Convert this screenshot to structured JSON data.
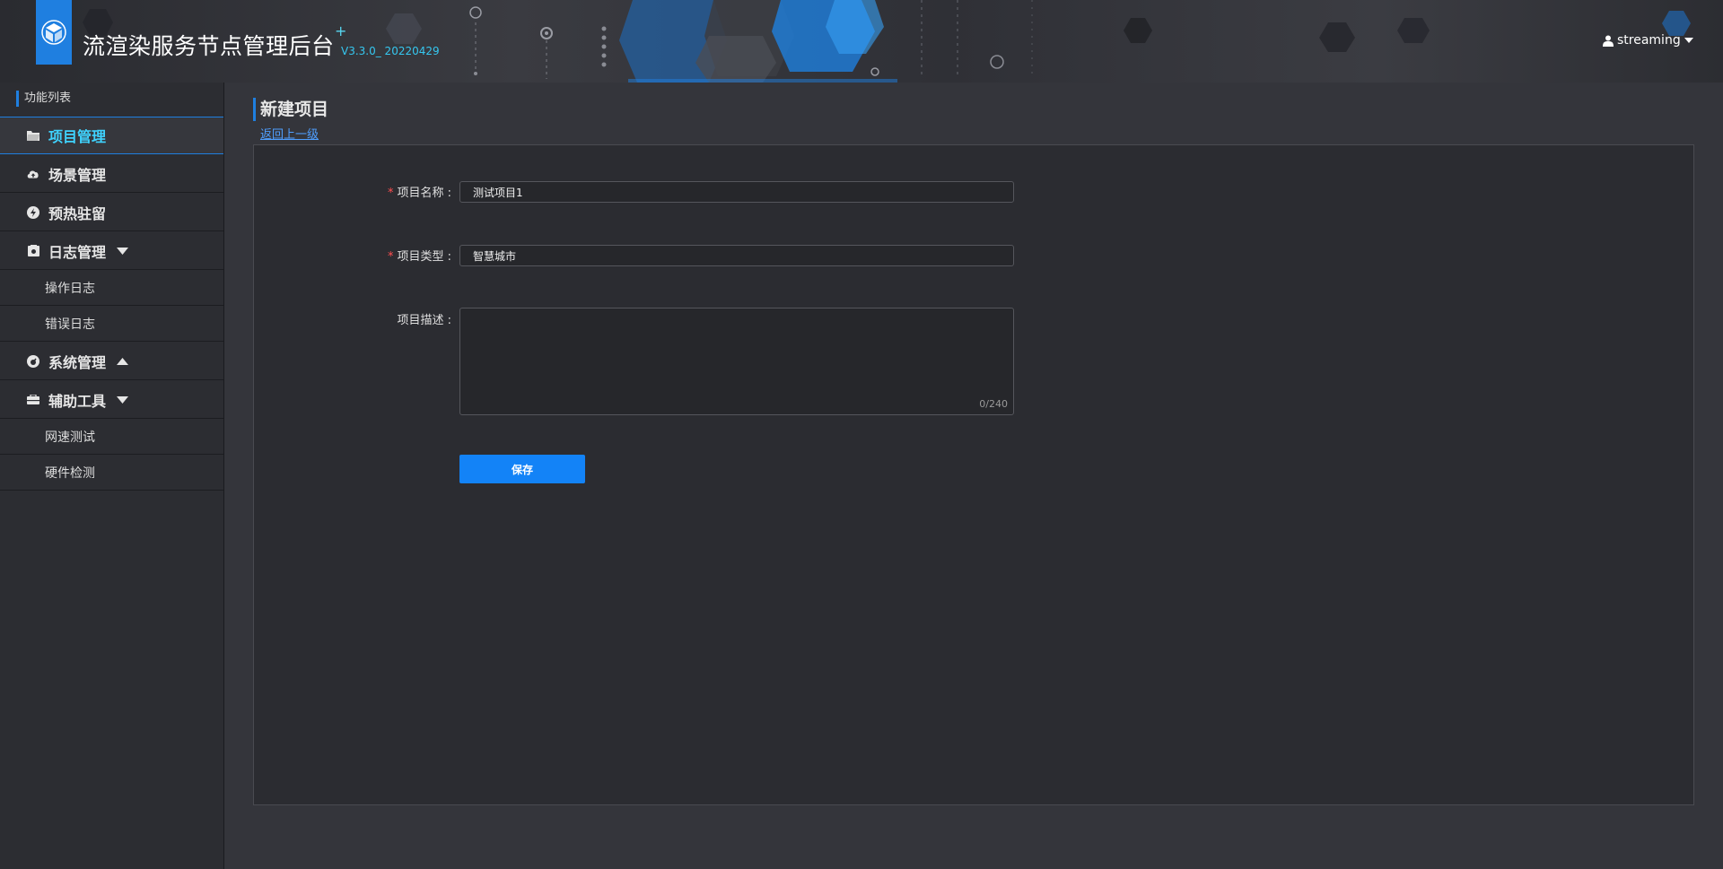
{
  "header": {
    "app_title": "流渲染服务节点管理后台",
    "title_mark": "+",
    "version": "V3.3.0_ 20220429",
    "username": "streaming",
    "logo_icon": "cube-logo-icon",
    "accent_color": "#1f7fe0"
  },
  "sidebar": {
    "heading": "功能列表",
    "items": [
      {
        "label": "项目管理",
        "icon": "folder-icon",
        "level": "top",
        "active": true
      },
      {
        "label": "场景管理",
        "icon": "cloud-upload-icon",
        "level": "top"
      },
      {
        "label": "预热驻留",
        "icon": "lightning-icon",
        "level": "top"
      },
      {
        "label": "日志管理",
        "icon": "log-box-icon",
        "level": "top",
        "caret": "down"
      },
      {
        "label": "操作日志",
        "level": "sub"
      },
      {
        "label": "错误日志",
        "level": "sub"
      },
      {
        "label": "系统管理",
        "icon": "gauge-icon",
        "level": "top",
        "caret": "up"
      },
      {
        "label": "辅助工具",
        "icon": "toolbox-icon",
        "level": "top",
        "caret": "down"
      },
      {
        "label": "网速测试",
        "level": "sub"
      },
      {
        "label": "硬件检测",
        "level": "sub"
      }
    ]
  },
  "main": {
    "page_title": "新建项目",
    "back_link": "返回上一级",
    "form": {
      "required_mark": "*",
      "name_label": "项目名称 :",
      "name_value": "测试项目1",
      "type_label": "项目类型 :",
      "type_value": "智慧城市",
      "desc_label": "项目描述 :",
      "desc_value": "",
      "desc_count": "0/240",
      "save_label": "保存"
    }
  }
}
